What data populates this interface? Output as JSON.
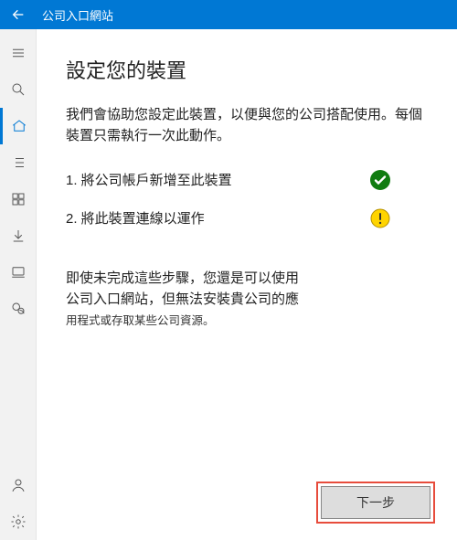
{
  "titlebar": {
    "title": "公司入口網站"
  },
  "page": {
    "heading": "設定您的裝置",
    "intro": "我們會協助您設定此裝置，以便與您的公司搭配使用。每個裝置只需執行一次此動作。"
  },
  "steps": [
    {
      "label": "1. 將公司帳戶新增至此裝置",
      "status": "done"
    },
    {
      "label": "2. 將此裝置連線以運作",
      "status": "warning"
    }
  ],
  "note": {
    "line1": "即使未完成這些步驟，您還是可以使用",
    "line2": "公司入口網站，但無法安裝貴公司的應",
    "line3": "用程式或存取某些公司資源。"
  },
  "footer": {
    "next": "下一步"
  },
  "icons": {
    "back": "back-arrow",
    "hamburger": "menu",
    "search": "search",
    "home": "home",
    "list": "list",
    "grid": "grid",
    "download": "download",
    "device": "device",
    "chat": "chat",
    "user": "user",
    "settings": "settings"
  }
}
